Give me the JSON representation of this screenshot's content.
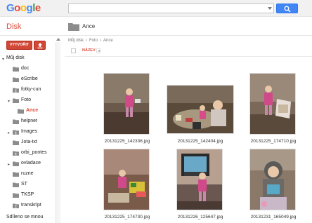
{
  "header": {
    "logo_letters": [
      "G",
      "o",
      "o",
      "g",
      "l",
      "e"
    ],
    "search": {
      "value": "",
      "placeholder": ""
    }
  },
  "app": {
    "name": "Disk"
  },
  "toolbar": {
    "create_label": "VYTVOŘIT"
  },
  "current_folder": {
    "title": "Ance"
  },
  "breadcrumb": [
    "Můj disk",
    "›",
    "Foto",
    "›",
    "Ance"
  ],
  "list": {
    "sort_label": "NÁZEV"
  },
  "sidebar": {
    "tree": [
      {
        "label": "Můj disk",
        "arrow": "▾"
      },
      {
        "label": "doc",
        "arrow": ""
      },
      {
        "label": "eScribe",
        "arrow": ""
      },
      {
        "label": "fotky-cun",
        "arrow": ""
      },
      {
        "label": "Foto",
        "arrow": "▾"
      },
      {
        "label": "Ance",
        "arrow": ""
      },
      {
        "label": "helpnet",
        "arrow": ""
      },
      {
        "label": "Images",
        "arrow": "▸"
      },
      {
        "label": "Jota-txt",
        "arrow": ""
      },
      {
        "label": "orbi_pontes",
        "arrow": ""
      },
      {
        "label": "ovladace",
        "arrow": "▸"
      },
      {
        "label": "ruzne",
        "arrow": ""
      },
      {
        "label": "ST",
        "arrow": ""
      },
      {
        "label": "TKSP",
        "arrow": ""
      },
      {
        "label": "transkript",
        "arrow": ""
      }
    ],
    "shared_label": "Sdíleno se mnou"
  },
  "files": [
    {
      "name": "20131225_142336.jpg"
    },
    {
      "name": "20131225_142404.jpg"
    },
    {
      "name": "20131225_174710.jpg"
    },
    {
      "name": "20131225_174730.jpg"
    },
    {
      "name": "20131226_125647.jpg"
    },
    {
      "name": "20131231_165049.jpg"
    }
  ],
  "colors": {
    "accent": "#dd4b39",
    "search_button": "#4285f4",
    "create_button": "#d14836"
  }
}
